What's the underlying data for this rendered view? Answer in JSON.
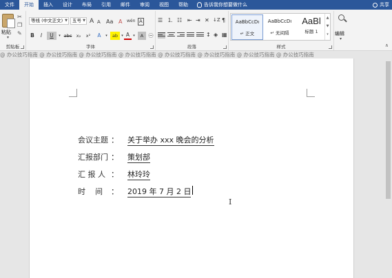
{
  "menubar": {
    "tabs": [
      "文件",
      "开始",
      "插入",
      "设计",
      "布局",
      "引用",
      "邮件",
      "审阅",
      "视图",
      "帮助"
    ],
    "active_tab": "开始",
    "tell_me": "告诉我你想要做什么",
    "share": "共享"
  },
  "ribbon": {
    "clipboard": {
      "paste_label": "粘贴",
      "group_label": "剪贴板"
    },
    "font": {
      "font_name": "等线 (中文正文)",
      "font_size": "五号",
      "bold": "B",
      "italic": "I",
      "underline": "U",
      "strike": "abc",
      "subscript": "x₂",
      "superscript": "x²",
      "grow": "A",
      "shrink": "A",
      "clear_format": "A",
      "phonetic": "wén",
      "font_color": "A",
      "highlight": "ab",
      "char_border": "A",
      "group_label": "字体"
    },
    "paragraph": {
      "group_label": "段落"
    },
    "styles": {
      "items": [
        {
          "sample": "AaBbCcDı",
          "name": "↵ 正文"
        },
        {
          "sample": "AaBbCcDı",
          "name": "↵ 无间隔"
        },
        {
          "sample": "AaBl",
          "name": "标题 1"
        }
      ],
      "group_label": "样式"
    },
    "editing": {
      "label": "编辑"
    }
  },
  "watermark": "@ 办公技巧指南 @ 办公技巧指南 @ 办公技巧指南 @ 办公技巧指南 @ 办公技巧指南 @ 办公技巧指南 @ 办公技巧指南 @ 办公技巧指南",
  "document": {
    "rows": [
      {
        "label": "会议主题",
        "colon": "：",
        "value": "关于举办 xxx 晚会的分析"
      },
      {
        "label": "汇报部门",
        "colon": "：",
        "value": "策划部"
      },
      {
        "label": "汇 报 人",
        "colon": "：",
        "value": "林玲玲"
      },
      {
        "label": "时    间",
        "colon": "：",
        "value": "2019 年 7 月 2 日"
      }
    ]
  },
  "colors": {
    "accent": "#2b579a",
    "ribbon": "#f3f3f3",
    "canvas": "#e6e6e6"
  }
}
